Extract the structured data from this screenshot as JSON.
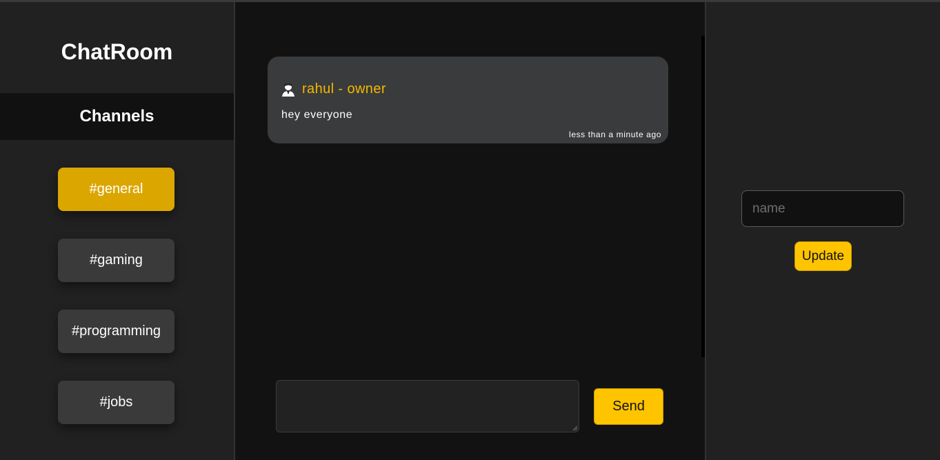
{
  "app": {
    "title": "ChatRoom"
  },
  "sidebar": {
    "header": "Channels",
    "channels": [
      {
        "label": "#general",
        "active": true
      },
      {
        "label": "#gaming",
        "active": false
      },
      {
        "label": "#programming",
        "active": false
      },
      {
        "label": "#jobs",
        "active": false
      }
    ]
  },
  "chat": {
    "messages": [
      {
        "author": "rahul - owner",
        "text": "hey everyone",
        "time": "less than a minute ago",
        "avatar_icon": "user-avatar-icon"
      }
    ],
    "composer": {
      "value": "",
      "send_label": "Send"
    }
  },
  "profile": {
    "name_placeholder": "name",
    "name_value": "",
    "update_label": "Update"
  },
  "colors": {
    "accent": "#ffc400",
    "active_channel": "#dba600",
    "author": "#f5b800",
    "sidebar_bg": "#212121",
    "main_bg": "#121212",
    "bubble_bg": "#3a3b3c"
  }
}
